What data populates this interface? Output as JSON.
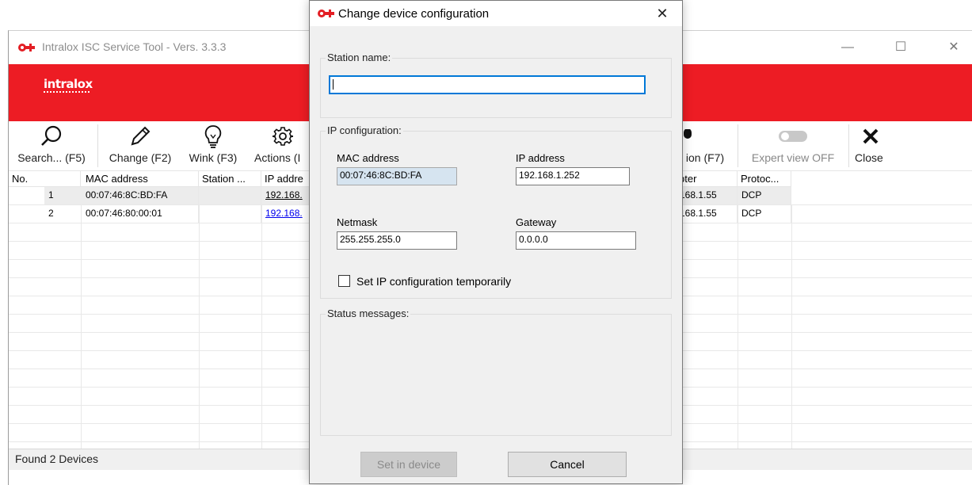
{
  "main_window": {
    "title": "Intralox ISC Service Tool - Vers. 3.3.3",
    "controls": {
      "minimize": "—",
      "maximize": "☐",
      "close": "✕"
    },
    "brand": "intralox",
    "toolbar": [
      {
        "id": "search",
        "label": "Search... (F5)",
        "icon": "search-icon"
      },
      {
        "id": "change",
        "label": "Change (F2)",
        "icon": "pencil-icon"
      },
      {
        "id": "wink",
        "label": "Wink (F3)",
        "icon": "lightbulb-icon"
      },
      {
        "id": "actions",
        "label": "Actions (I",
        "icon": "gear-icon"
      },
      {
        "id": "adapter",
        "label": "ion (F7)",
        "icon": "network-icon"
      },
      {
        "id": "expert",
        "label": "Expert view OFF",
        "icon": "toggle-icon"
      },
      {
        "id": "close",
        "label": "Close",
        "icon": "close-x-icon"
      }
    ],
    "grid": {
      "columns": [
        "No.",
        "MAC address",
        "Station ...",
        "IP addre",
        "pter",
        "Protoc..."
      ],
      "rows": [
        {
          "no": "1",
          "mac": "00:07:46:8C:BD:FA",
          "station": "",
          "ip": "192.168.",
          "adapter": "168.1.55",
          "protocol": "DCP"
        },
        {
          "no": "2",
          "mac": "00:07:46:80:00:01",
          "station": "",
          "ip": "192.168.",
          "adapter": "168.1.55",
          "protocol": "DCP"
        }
      ]
    },
    "status": "Found 2 Devices"
  },
  "dialog": {
    "title": "Change device configuration",
    "close_glyph": "✕",
    "station_group": "Station name:",
    "station_value": "",
    "ip_group": "IP configuration:",
    "mac_label": "MAC address",
    "mac_value": "00:07:46:8C:BD:FA",
    "ip_label": "IP address",
    "ip_value": "192.168.1.252",
    "netmask_label": "Netmask",
    "netmask_value": "255.255.255.0",
    "gateway_label": "Gateway",
    "gateway_value": "0.0.0.0",
    "temp_checkbox_label": "Set IP configuration temporarily",
    "temp_checked": false,
    "status_group": "Status messages:",
    "set_button": "Set in device",
    "cancel_button": "Cancel"
  },
  "colors": {
    "brand_red": "#ed1c24",
    "link_blue": "#0000ee",
    "focus_blue": "#0078d7"
  }
}
